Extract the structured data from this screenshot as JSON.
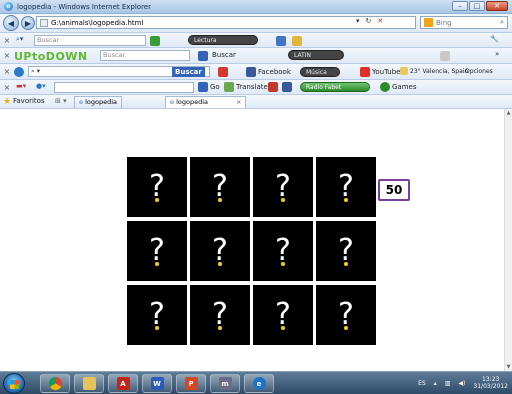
{
  "window": {
    "title": "logopedia - Windows Internet Explorer",
    "min": "–",
    "max": "□",
    "close": "✕"
  },
  "address": {
    "url": "G:\\animals\\logopedia.html",
    "refresh": "↻",
    "stop": "✕",
    "search_placeholder": "Bing"
  },
  "toolbar1": {
    "search_placeholder": "Buscar",
    "pill": "Lectura"
  },
  "toolbar2": {
    "logo_main": "UPtoDOWN",
    "search_placeholder": "Buscar",
    "buscar": "Buscar",
    "pill": "LATIN"
  },
  "toolbar3": {
    "buscar": "Buscar",
    "facebook": "Facebook",
    "musica": "Música",
    "youtube": "YouTube",
    "weather": "23° Valencia, Spain",
    "opciones": "Opciones"
  },
  "toolbar4": {
    "go": "Go",
    "translate": "Translate",
    "radio": "Radio Fabet",
    "games": "Games"
  },
  "favorites": {
    "label": "Favoritos",
    "tabs": [
      {
        "label": "logopedia"
      },
      {
        "label": "logopedia"
      }
    ]
  },
  "game": {
    "score": "50",
    "cards": [
      "?",
      "?",
      "?",
      "?",
      "?",
      "?",
      "?",
      "?",
      "?",
      "?",
      "?",
      "?"
    ]
  },
  "taskbar": {
    "lang": "ES",
    "time": "13:23",
    "date": "31/03/2012"
  },
  "colors": {
    "card_bg": "#000000",
    "question_dot": "#f4d21c",
    "score_border": "#7b3f9e"
  }
}
